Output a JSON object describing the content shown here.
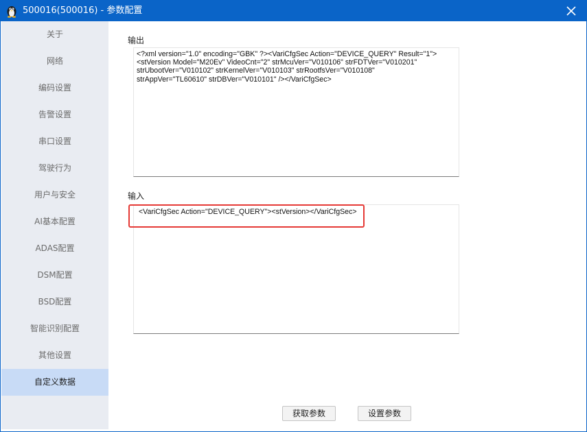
{
  "window": {
    "title": "500016(500016) - 参数配置",
    "icons": {
      "app": "tux-app-icon",
      "close": "close-icon"
    }
  },
  "sidebar": {
    "items": [
      {
        "label": "关于"
      },
      {
        "label": "网络"
      },
      {
        "label": "编码设置"
      },
      {
        "label": "告警设置"
      },
      {
        "label": "串口设置"
      },
      {
        "label": "驾驶行为"
      },
      {
        "label": "用户与安全"
      },
      {
        "label": "AI基本配置"
      },
      {
        "label": "ADAS配置"
      },
      {
        "label": "DSM配置"
      },
      {
        "label": "BSD配置"
      },
      {
        "label": "智能识别配置"
      },
      {
        "label": "其他设置"
      },
      {
        "label": "自定义数据"
      }
    ],
    "active": "自定义数据"
  },
  "output": {
    "label": "输出",
    "text": "<?xml version=\"1.0\" encoding=\"GBK\" ?><VariCfgSec Action=\"DEVICE_QUERY\" Result=\"1\">\n<stVersion Model=\"M20Ev\" VideoCnt=\"2\" strMcuVer=\"V010106\" strFDTVer=\"V010201\"\nstrUbootVer=\"V010102\" strKernelVer=\"V010103\" strRootfsVer=\"V010108\"\nstrAppVer=\"TL60610\" strDBVer=\"V010101\" /></VariCfgSec>"
  },
  "input": {
    "label": "输入",
    "text": "<VariCfgSec Action=\"DEVICE_QUERY\"><stVersion></VariCfgSec>"
  },
  "buttons": {
    "get_params": "获取参数",
    "set_params": "设置参数"
  },
  "colors": {
    "titlebar": "#0a64c8",
    "sidebar_bg": "#e9ecf2",
    "sidebar_active": "#c8dbf6",
    "highlight": "#e53935"
  }
}
